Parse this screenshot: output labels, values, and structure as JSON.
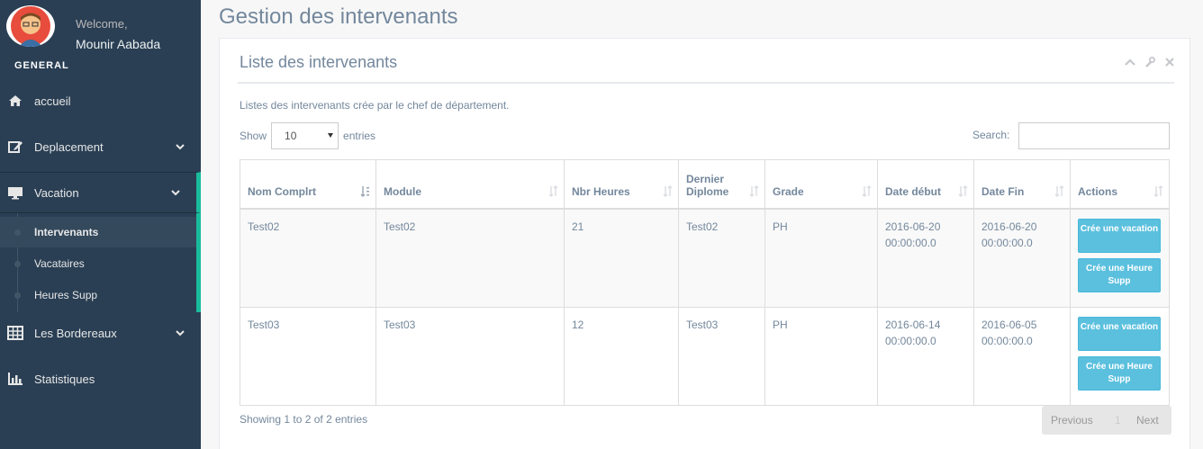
{
  "sidebar": {
    "welcome": "Welcome,",
    "username": "Mounir Aabada",
    "section": "GENERAL",
    "items": [
      {
        "label": "accueil"
      },
      {
        "label": "Deplacement"
      },
      {
        "label": "Vacation"
      },
      {
        "label": "Les Bordereaux"
      },
      {
        "label": "Statistiques"
      }
    ],
    "submenu": [
      {
        "label": "Intervenants"
      },
      {
        "label": "Vacataires"
      },
      {
        "label": "Heures Supp"
      }
    ]
  },
  "page": {
    "title": "Gestion des intervenants"
  },
  "panel": {
    "title": "Liste des intervenants",
    "description": "Listes des intervenants crée par le chef de département."
  },
  "table_controls": {
    "show_label": "Show",
    "length_value": "10",
    "entries_label": "entries",
    "search_label": "Search:"
  },
  "table": {
    "headers": [
      "Nom Complrt",
      "Module",
      "Nbr Heures",
      "Dernier Diplome",
      "Grade",
      "Date début",
      "Date Fin",
      "Actions"
    ],
    "rows": [
      {
        "nom": "Test02",
        "module": "Test02",
        "heures": "21",
        "diplome": "Test02",
        "grade": "PH",
        "debut": "2016-06-20 00:00:00.0",
        "fin": "2016-06-20 00:00:00.0"
      },
      {
        "nom": "Test03",
        "module": "Test03",
        "heures": "12",
        "diplome": "Test03",
        "grade": "PH",
        "debut": "2016-06-14 00:00:00.0",
        "fin": "2016-06-05 00:00:00.0"
      }
    ],
    "btn_vacation": "Crée une vacation",
    "btn_heure": "Crée une Heure Supp"
  },
  "footer": {
    "info": "Showing 1 to 2 of 2 entries",
    "prev": "Previous",
    "page": "1",
    "next": "Next"
  },
  "colors": {
    "sidebar_bg": "#2A3F54",
    "accent": "#1ABB9C",
    "button": "#5BC0DE"
  }
}
